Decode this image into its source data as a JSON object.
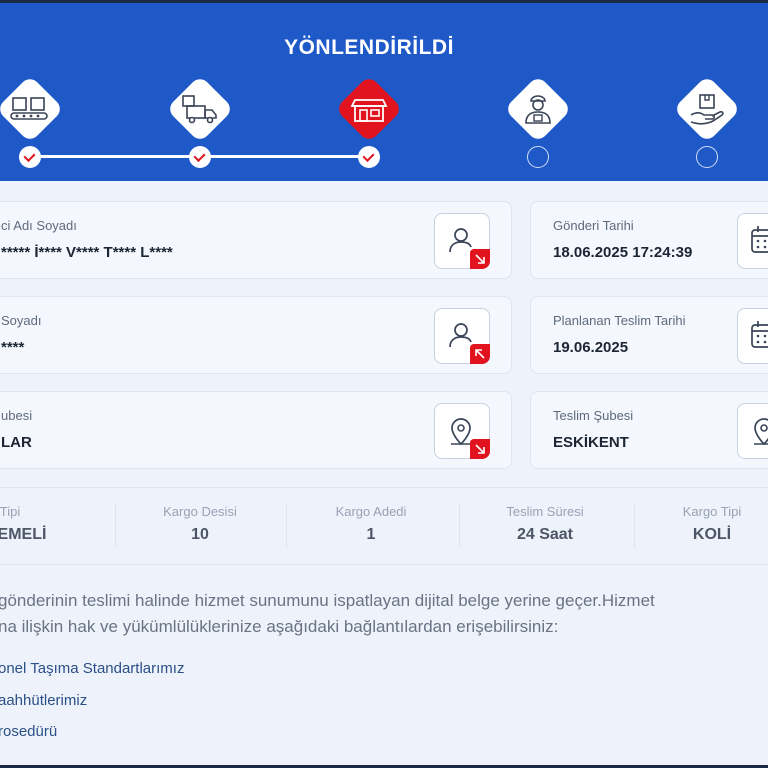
{
  "status": {
    "title": "YÖNLENDİRİLDİ"
  },
  "steps": [
    {
      "icon": "conveyor-boxes-icon",
      "state": "done"
    },
    {
      "icon": "delivery-truck-icon",
      "state": "done"
    },
    {
      "icon": "branch-store-icon",
      "state": "done",
      "active": true
    },
    {
      "icon": "courier-icon",
      "state": "pending"
    },
    {
      "icon": "package-hand-icon",
      "state": "pending"
    }
  ],
  "cards": {
    "sender_name": {
      "label": "ci Adı Soyadı",
      "value": "***** İ**** V**** T**** L****",
      "icon": "user-outgoing-icon"
    },
    "receiver_name": {
      "label": "Soyadı",
      "value": "****",
      "icon": "user-incoming-icon"
    },
    "sender_branch": {
      "label": "ubesi",
      "value": "LAR",
      "icon": "location-pin-icon"
    },
    "shipment_date": {
      "label": "Gönderi Tarihi",
      "value": "18.06.2025 17:24:39",
      "icon": "calendar-icon"
    },
    "planned_delivery": {
      "label": "Planlanan Teslim Tarihi",
      "value": "19.06.2025",
      "icon": "calendar-icon"
    },
    "delivery_branch": {
      "label": "Teslim Şubesi",
      "value": "ESKİKENT",
      "icon": "location-pin-icon"
    }
  },
  "stats": [
    {
      "label": "Tipi",
      "value": "ÖDEMELİ"
    },
    {
      "label": "Kargo Desisi",
      "value": "10"
    },
    {
      "label": "Kargo Adedi",
      "value": "1"
    },
    {
      "label": "Teslim Süresi",
      "value": "24 Saat"
    },
    {
      "label": "Kargo Tipi",
      "value": "KOLİ"
    }
  ],
  "info": {
    "line1": "gönderinin teslimi halinde hizmet sunumunu ispatlayan dijital belge yerine geçer.Hizmet",
    "line2": "na ilişkin hak ve yükümlülüklerinize aşağıdaki bağlantılardan erişebilirsiniz:"
  },
  "links": [
    {
      "label": "onel Taşıma Standartlarımız"
    },
    {
      "label": "aahhütlerimiz"
    },
    {
      "label": "rosedürü"
    }
  ],
  "colors": {
    "brand_blue": "#1f59c8",
    "accent_red": "#e0131e"
  }
}
